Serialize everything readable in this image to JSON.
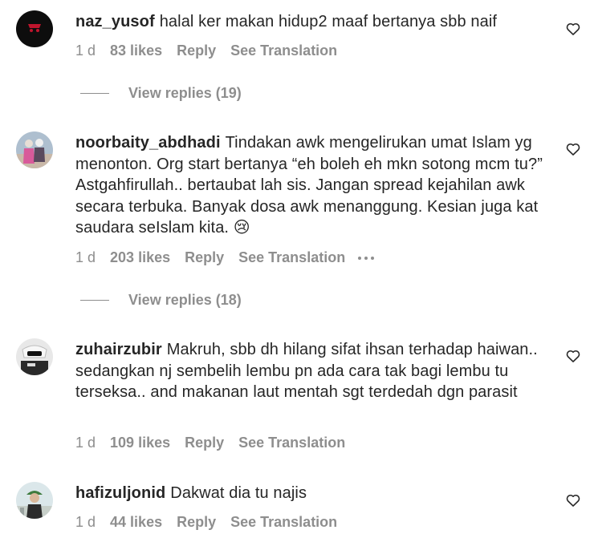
{
  "comments": [
    {
      "username": "naz_yusof",
      "text": "halal ker makan hidup2 maaf bertanya sbb naif",
      "time": "1 d",
      "likes": "83 likes",
      "reply": "Reply",
      "translate": "See Translation",
      "view_replies": "View replies (19)"
    },
    {
      "username": "noorbaity_abdhadi",
      "text": "Tindakan awk mengelirukan umat Islam yg menonton. Org start bertanya “eh boleh eh mkn sotong mcm tu?” Astgahfirullah.. bertaubat lah sis. Jangan spread kejahilan awk secara terbuka. Banyak dosa awk menanggung. Kesian juga kat saudara seIslam kita. 😢",
      "time": "1 d",
      "likes": "203 likes",
      "reply": "Reply",
      "translate": "See Translation",
      "view_replies": "View replies (18)"
    },
    {
      "username": "zuhairzubir",
      "text": "Makruh, sbb dh hilang sifat ihsan terhadap haiwan.. sedangkan nj sembelih lembu pn ada cara tak bagi lembu tu terseksa.. and makanan laut mentah sgt terdedah dgn parasit",
      "time": "1 d",
      "likes": "109 likes",
      "reply": "Reply",
      "translate": "See Translation"
    },
    {
      "username": "hafizuljonid",
      "text": "Dakwat dia tu najis",
      "time": "1 d",
      "likes": "44 likes",
      "reply": "Reply",
      "translate": "See Translation"
    }
  ],
  "icons": {
    "like": "heart-outline-icon",
    "more": "more-options-icon"
  },
  "colors": {
    "text": "#262626",
    "secondary": "#8e8e8e"
  }
}
